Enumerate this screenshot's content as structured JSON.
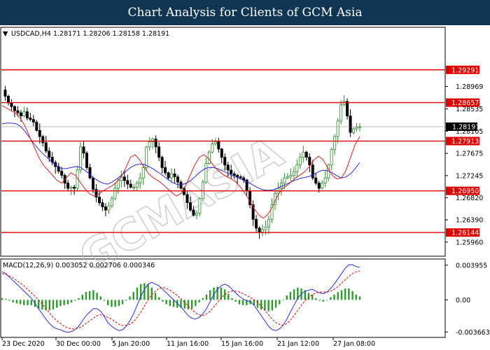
{
  "header": {
    "title": "Chart Analysis for Clients of GCM Asia"
  },
  "colors": {
    "title_bg": "#0f3552",
    "bull": "#2e8b2e",
    "bear": "#000000",
    "ma_fast": "#d81f1f",
    "ma_slow": "#2a2ae0",
    "level": "#e00000",
    "price_line": "#777777",
    "macd_line": "#2a2ae0",
    "signal_line": "#e00000",
    "histogram": "#2e9a2e"
  },
  "watermark": "GCMASIA",
  "chart_data": [
    {
      "type": "candlestick",
      "symbol_info": "USDCAD,H4  1.28171 1.28206 1.28158 1.28191",
      "ylim": [
        1.257,
        1.301
      ],
      "y_ticks": [
        "1.28969",
        "1.28535",
        "1.28105",
        "1.27675",
        "1.27245",
        "1.26820",
        "1.26390",
        "1.25960"
      ],
      "current_price": "1.28191",
      "levels": [
        {
          "value": 1.29291,
          "label": "1.29291"
        },
        {
          "value": 1.28657,
          "label": "1.28657"
        },
        {
          "value": 1.27913,
          "label": "1.27913"
        },
        {
          "value": 1.2695,
          "label": "1.26950"
        },
        {
          "value": 1.26144,
          "label": "1.26144"
        }
      ],
      "x_labels": [
        "23 Dec 2020",
        "30 Dec 00:00",
        "5 Jan 20:00",
        "11 Jan 16:00",
        "15 Jan 16:00",
        "21 Jan 12:00",
        "27 Jan 08:00"
      ],
      "close_path": [
        1.289,
        1.2878,
        1.2865,
        1.2858,
        1.285,
        1.2846,
        1.284,
        1.2848,
        1.2836,
        1.2833,
        1.2828,
        1.2812,
        1.28,
        1.2788,
        1.2772,
        1.276,
        1.275,
        1.2742,
        1.2733,
        1.2725,
        1.271,
        1.27,
        1.2702,
        1.27,
        1.2736,
        1.278,
        1.2768,
        1.274,
        1.272,
        1.2698,
        1.2683,
        1.2672,
        1.2664,
        1.2658,
        1.2666,
        1.268,
        1.27,
        1.2715,
        1.2722,
        1.2715,
        1.2708,
        1.2702,
        1.2702,
        1.271,
        1.272,
        1.274,
        1.278,
        1.279,
        1.2795,
        1.278,
        1.276,
        1.274,
        1.273,
        1.272,
        1.2728,
        1.2722,
        1.2712,
        1.27,
        1.2688,
        1.2672,
        1.2658,
        1.2648,
        1.2652,
        1.268,
        1.2712,
        1.2748,
        1.277,
        1.2786,
        1.279,
        1.2776,
        1.276,
        1.2745,
        1.2735,
        1.2728,
        1.2725,
        1.2722,
        1.272,
        1.2716,
        1.2695,
        1.2668,
        1.264,
        1.2623,
        1.2615,
        1.262,
        1.2625,
        1.264,
        1.2668,
        1.269,
        1.27,
        1.271,
        1.272,
        1.2722,
        1.2725,
        1.2732,
        1.2745,
        1.276,
        1.277,
        1.276,
        1.2745,
        1.272,
        1.271,
        1.27,
        1.271,
        1.272,
        1.2745,
        1.2775,
        1.28,
        1.283,
        1.2862,
        1.2868,
        1.284,
        1.2808,
        1.2815,
        1.2818,
        1.2819
      ],
      "ma_fast": [
        1.286,
        1.2855,
        1.285,
        1.2845,
        1.2835,
        1.282,
        1.28,
        1.278,
        1.276,
        1.2745,
        1.2735,
        1.2725,
        1.2715,
        1.271,
        1.272,
        1.273,
        1.2725,
        1.2712,
        1.27,
        1.269,
        1.2685,
        1.2688,
        1.2695,
        1.27,
        1.2705,
        1.2712,
        1.2722,
        1.274,
        1.276,
        1.2765,
        1.2755,
        1.274,
        1.2728,
        1.272,
        1.2715,
        1.2708,
        1.27,
        1.2692,
        1.2685,
        1.269,
        1.2705,
        1.2725,
        1.2745,
        1.276,
        1.2765,
        1.2758,
        1.2745,
        1.2735,
        1.2728,
        1.2722,
        1.2718,
        1.2712,
        1.2702,
        1.269,
        1.2675,
        1.266,
        1.2648,
        1.2642,
        1.265,
        1.2665,
        1.2685,
        1.2698,
        1.2705,
        1.2712,
        1.272,
        1.2726,
        1.2732,
        1.2742,
        1.2755,
        1.2762,
        1.2755,
        1.274,
        1.2725,
        1.2718,
        1.272,
        1.2735,
        1.276,
        1.2785,
        1.28
      ],
      "ma_slow": [
        1.2825,
        1.2826,
        1.2826,
        1.2825,
        1.282,
        1.281,
        1.2798,
        1.2786,
        1.2775,
        1.2766,
        1.2758,
        1.275,
        1.2743,
        1.2738,
        1.2738,
        1.274,
        1.2742,
        1.2741,
        1.2735,
        1.2728,
        1.272,
        1.2714,
        1.271,
        1.2708,
        1.2712,
        1.2718,
        1.2725,
        1.2733,
        1.274,
        1.2745,
        1.2747,
        1.2746,
        1.2742,
        1.2737,
        1.2731,
        1.2725,
        1.2718,
        1.2712,
        1.2708,
        1.2707,
        1.2709,
        1.2714,
        1.2722,
        1.273,
        1.2737,
        1.274,
        1.274,
        1.2738,
        1.2734,
        1.273,
        1.2726,
        1.2722,
        1.2718,
        1.2714,
        1.271,
        1.2705,
        1.27,
        1.2697,
        1.2696,
        1.2697,
        1.27,
        1.2704,
        1.2708,
        1.2712,
        1.2716,
        1.2719,
        1.2721,
        1.2723,
        1.2727,
        1.2732,
        1.2735,
        1.2734,
        1.273,
        1.2724,
        1.272,
        1.2722,
        1.2728,
        1.2738,
        1.275
      ]
    },
    {
      "type": "macd",
      "header": "MACD(12,26,9) 0.003052 0.002706 0.000346",
      "ylim": [
        -0.0042,
        0.0045
      ],
      "y_ticks": [
        "0.003955",
        "0.00",
        "-0.003663"
      ],
      "tick_values": [
        0.003955,
        0.0,
        -0.003663
      ],
      "macd_line": [
        0.0032,
        0.003,
        0.0026,
        0.0022,
        0.0018,
        0.0014,
        0.001,
        0.0006,
        0.0002,
        -0.0004,
        -0.001,
        -0.0016,
        -0.0022,
        -0.0027,
        -0.0031,
        -0.0033,
        -0.0034,
        -0.0036,
        -0.0037,
        -0.0036,
        -0.0034,
        -0.003,
        -0.0024,
        -0.0018,
        -0.0014,
        -0.001,
        -0.001,
        -0.0013,
        -0.0019,
        -0.0026,
        -0.003,
        -0.0033,
        -0.0035,
        -0.0034,
        -0.003,
        -0.0024,
        -0.0016,
        -0.0006,
        0.0004,
        0.0012,
        0.0018,
        0.002,
        0.0018,
        0.0016,
        0.0012,
        0.0008,
        0.0004,
        0.0,
        -0.0004,
        -0.0008,
        -0.0013,
        -0.0018,
        -0.0021,
        -0.0022,
        -0.002,
        -0.0016,
        -0.001,
        -0.0002,
        0.0006,
        0.0012,
        0.0016,
        0.0018,
        0.0016,
        0.0012,
        0.0008,
        0.0004,
        0.0001,
        -0.0001,
        -0.0002,
        -0.0006,
        -0.0012,
        -0.0018,
        -0.0024,
        -0.003,
        -0.0034,
        -0.0035,
        -0.0033,
        -0.0029,
        -0.0022,
        -0.0014,
        -0.0006,
        0.0002,
        0.0007,
        0.001,
        0.0011,
        0.0012,
        0.001,
        0.0008,
        0.0007,
        0.0009,
        0.0013,
        0.0018,
        0.0024,
        0.003,
        0.0036,
        0.004,
        0.004,
        0.0038,
        0.0037
      ],
      "signal_line": [
        0.003,
        0.0029,
        0.0027,
        0.0025,
        0.0022,
        0.0019,
        0.0016,
        0.0012,
        0.0008,
        0.0004,
        0.0,
        -0.0005,
        -0.001,
        -0.0015,
        -0.002,
        -0.0024,
        -0.0027,
        -0.003,
        -0.0032,
        -0.0033,
        -0.0033,
        -0.0032,
        -0.003,
        -0.0027,
        -0.0024,
        -0.0021,
        -0.0018,
        -0.0017,
        -0.0018,
        -0.002,
        -0.0022,
        -0.0025,
        -0.0028,
        -0.0029,
        -0.0029,
        -0.0028,
        -0.0025,
        -0.002,
        -0.0014,
        -0.0007,
        0.0,
        0.0006,
        0.001,
        0.0013,
        0.0014,
        0.0013,
        0.0011,
        0.0008,
        0.0005,
        0.0001,
        -0.0003,
        -0.0007,
        -0.0011,
        -0.0015,
        -0.0017,
        -0.0018,
        -0.0016,
        -0.0013,
        -0.0008,
        -0.0003,
        0.0002,
        0.0006,
        0.0009,
        0.001,
        0.001,
        0.0009,
        0.0007,
        0.0005,
        0.0003,
        0.0,
        -0.0003,
        -0.0007,
        -0.0012,
        -0.0017,
        -0.0022,
        -0.0026,
        -0.0028,
        -0.0029,
        -0.0027,
        -0.0023,
        -0.0018,
        -0.0012,
        -0.0006,
        -0.0001,
        0.0003,
        0.0006,
        0.0008,
        0.0009,
        0.0009,
        0.0009,
        0.001,
        0.0012,
        0.0015,
        0.0019,
        0.0023,
        0.0027,
        0.003,
        0.0032,
        0.0033
      ]
    }
  ]
}
